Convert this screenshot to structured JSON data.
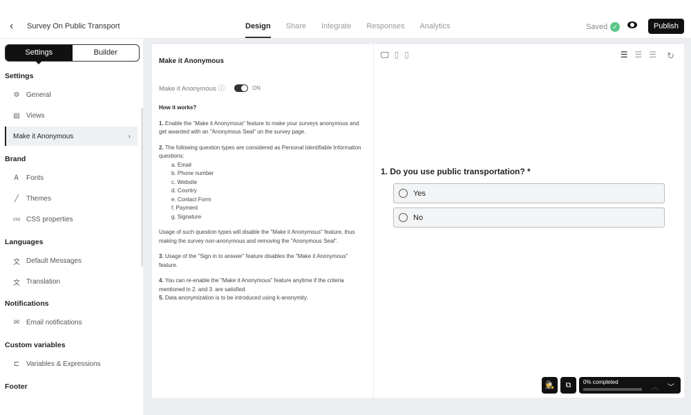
{
  "header": {
    "back": "‹",
    "title": "Survey On Public Transport",
    "tabs": [
      "Design",
      "Share",
      "Integrate",
      "Responses",
      "Analytics"
    ],
    "active_tab": "Design",
    "saved": "Saved",
    "publish": "Publish"
  },
  "sidebar": {
    "segments": [
      "Settings",
      "Builder"
    ],
    "sections": [
      {
        "title": "Settings",
        "items": [
          {
            "icon": "gear-icon",
            "label": "General"
          },
          {
            "icon": "views-icon",
            "label": "Views"
          },
          {
            "icon": "",
            "label": "Make it Anonymous",
            "selected": true
          }
        ]
      },
      {
        "title": "Brand",
        "items": [
          {
            "icon": "fonts-icon",
            "label": "Fonts"
          },
          {
            "icon": "brush-icon",
            "label": "Themes"
          },
          {
            "icon": "css-icon",
            "label": "CSS properties"
          }
        ]
      },
      {
        "title": "Languages",
        "items": [
          {
            "icon": "translate-icon",
            "label": "Default Messages"
          },
          {
            "icon": "translate-icon",
            "label": "Translation"
          }
        ]
      },
      {
        "title": "Notifications",
        "items": [
          {
            "icon": "mail-icon",
            "label": "Email notifications"
          }
        ]
      },
      {
        "title": "Custom variables",
        "items": [
          {
            "icon": "variables-icon",
            "label": "Variables & Expressions"
          }
        ]
      },
      {
        "title": "Footer",
        "items": []
      }
    ]
  },
  "panel": {
    "title": "Make it Anonymous",
    "toggle_label": "Make it Anonymous ⓘ",
    "toggle_state": "ON",
    "how_title": "How it works?",
    "p1_num": "1.",
    "p1": " Enable the \"Make it Anonymous\" feature to make your surveys anonymous and get awarded with an \"Anonymous Seal\" on the survey page.",
    "p2_num": "2.",
    "p2": " The following question types are considered as Personal Identifiable Information questions:",
    "list": [
      "a. Email",
      "b. Phone number",
      "c. Website",
      "d. Country",
      "e. Contact Form",
      "f. Payment",
      "g. Signature"
    ],
    "p_usage": "Usage of such question types will disable the \"Make it Anonymous\" feature, thus making the survey non-anonymous and removing the \"Anonymous Seal\".",
    "p3_num": "3.",
    "p3": " Usage of the \"Sign in to answer\" feature disables the \"Make it Anonymous\" feature.",
    "p4_num": "4.",
    "p4": " You can re-enable the \"Make it Anonymous\" feature anytime if the criteria mentioned in 2. and 3. are satisfied.",
    "p5_num": "5.",
    "p5": " Data anonymization is to be introduced using k-anonymity."
  },
  "preview": {
    "question": "1.  Do you use public transportation? *",
    "options": [
      "Yes",
      "No"
    ],
    "progress_text": "0% completed",
    "progress": 0
  }
}
